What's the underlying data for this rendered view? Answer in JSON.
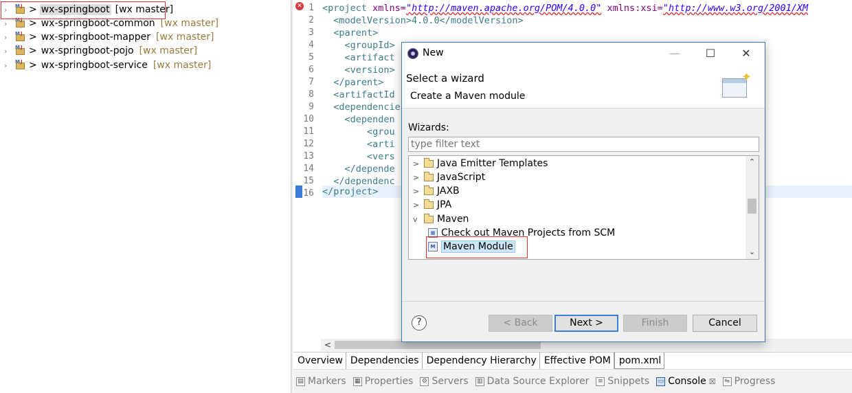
{
  "explorer": {
    "projects": [
      {
        "prefix": ">",
        "name": "wx-springboot",
        "branch": "[wx master]",
        "selected": true
      },
      {
        "prefix": ">",
        "name": "wx-springboot-common",
        "branch": "[wx master]"
      },
      {
        "prefix": ">",
        "name": "wx-springboot-mapper",
        "branch": "[wx master]"
      },
      {
        "prefix": ">",
        "name": "wx-springboot-pojo",
        "branch": "[wx master]"
      },
      {
        "prefix": ">",
        "name": "wx-springboot-service",
        "branch": "[wx master]"
      }
    ]
  },
  "editor": {
    "line_numbers": [
      "1",
      "2",
      "3",
      "4",
      "5",
      "6",
      "7",
      "8",
      "9",
      "10",
      "11",
      "12",
      "13",
      "14",
      "15",
      "16"
    ],
    "lines": [
      {
        "open": "<project",
        "attr1": " xmlns=",
        "val1": "\"http://maven.apache.org/POM/4.0.0\"",
        "attr2": " xmlns:xsi=",
        "val2": "\"http://www.w3.org/2001/XM"
      },
      {
        "text": "  <modelVersion>4.0.0</modelVersion>"
      },
      {
        "text": "  <parent>"
      },
      {
        "text": "    <groupId>"
      },
      {
        "text": "    <artifact"
      },
      {
        "text": "    <version>"
      },
      {
        "text": "  </parent>"
      },
      {
        "text": "  <artifactId"
      },
      {
        "text": "  <dependencie"
      },
      {
        "text": "    <dependen"
      },
      {
        "text": "        <grou"
      },
      {
        "text": "        <arti"
      },
      {
        "text": "        <vers"
      },
      {
        "text": "    </depende"
      },
      {
        "text": "  </dependenc"
      },
      {
        "text": "</project>"
      }
    ],
    "tabs": [
      "Overview",
      "Dependencies",
      "Dependency Hierarchy",
      "Effective POM",
      "pom.xml"
    ],
    "active_tab": "pom.xml",
    "scroll_left": "<"
  },
  "bottom_panel": {
    "tabs": [
      {
        "label": "Markers",
        "icon": "markers-icon"
      },
      {
        "label": "Properties",
        "icon": "properties-icon"
      },
      {
        "label": "Servers",
        "icon": "servers-icon"
      },
      {
        "label": "Data Source Explorer",
        "icon": "data-source-icon"
      },
      {
        "label": "Snippets",
        "icon": "snippets-icon"
      },
      {
        "label": "Console",
        "icon": "console-icon",
        "active": true,
        "close": "☒"
      },
      {
        "label": "Progress",
        "icon": "progress-icon"
      }
    ]
  },
  "dialog": {
    "title": "New",
    "window_buttons": {
      "minimize": "—",
      "maximize": "☐",
      "close": "✕"
    },
    "heading": "Select a wizard",
    "subheading": "Create a Maven module",
    "wizards_label": "Wizards:",
    "filter_placeholder": "type filter text",
    "items": [
      {
        "label": "Java Emitter Templates",
        "kind": "folder",
        "twisty": ">"
      },
      {
        "label": "JavaScript",
        "kind": "folder",
        "twisty": ">"
      },
      {
        "label": "JAXB",
        "kind": "folder",
        "twisty": ">"
      },
      {
        "label": "JPA",
        "kind": "folder",
        "twisty": ">"
      },
      {
        "label": "Maven",
        "kind": "folder",
        "twisty": "v"
      },
      {
        "label": "Check out Maven Projects from SCM",
        "kind": "item"
      },
      {
        "label": "Maven Module",
        "kind": "item",
        "selected": true
      }
    ],
    "help": "?",
    "buttons": {
      "back": "< Back",
      "next": "Next >",
      "finish": "Finish",
      "cancel": "Cancel"
    }
  },
  "colors": {
    "highlight_box": "#e03030",
    "selection": "#cce4f7",
    "dialog_border": "#3c78c8"
  }
}
